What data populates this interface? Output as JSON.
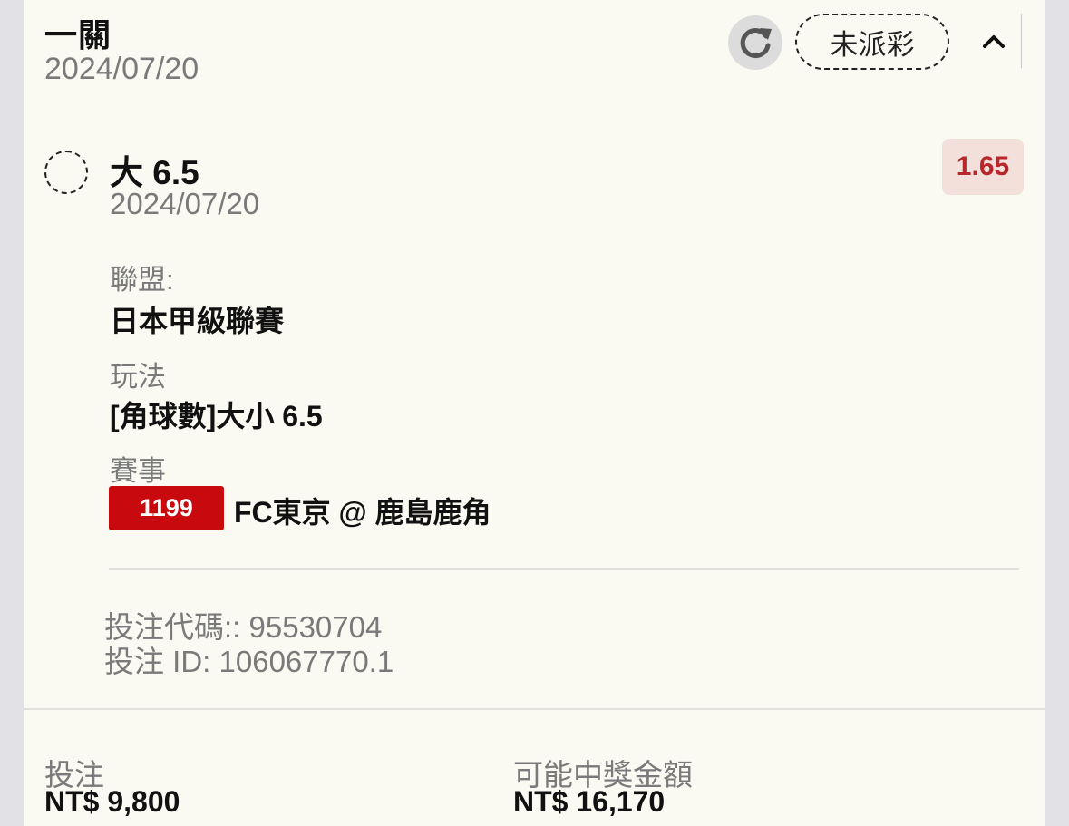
{
  "header": {
    "title": "一關",
    "date": "2024/07/20",
    "status_label": "未派彩"
  },
  "selection": {
    "name": "大 6.5",
    "date": "2024/07/20",
    "odds": "1.65",
    "league_label": "聯盟:",
    "league_value": "日本甲級聯賽",
    "market_label": "玩法",
    "market_value": "[角球數]大小 6.5",
    "event_label": "賽事",
    "match_code": "1199",
    "match_name": "FC東京 @ 鹿島鹿角"
  },
  "bet_info": {
    "bet_code": "投注代碼:: 95530704",
    "bet_id": "投注 ID: 106067770.1"
  },
  "footer": {
    "stake_label": "投注",
    "stake_value": "NT$ 9,800",
    "payout_label": "可能中獎金額",
    "payout_value": "NT$ 16,170"
  },
  "colors": {
    "accent_red": "#c80a0f",
    "odds_text": "#b8272c",
    "odds_bg": "#f4e0db",
    "card_bg": "#fbfaf2"
  },
  "icons": {
    "refresh": "refresh-icon",
    "collapse": "chevron-up-icon"
  }
}
